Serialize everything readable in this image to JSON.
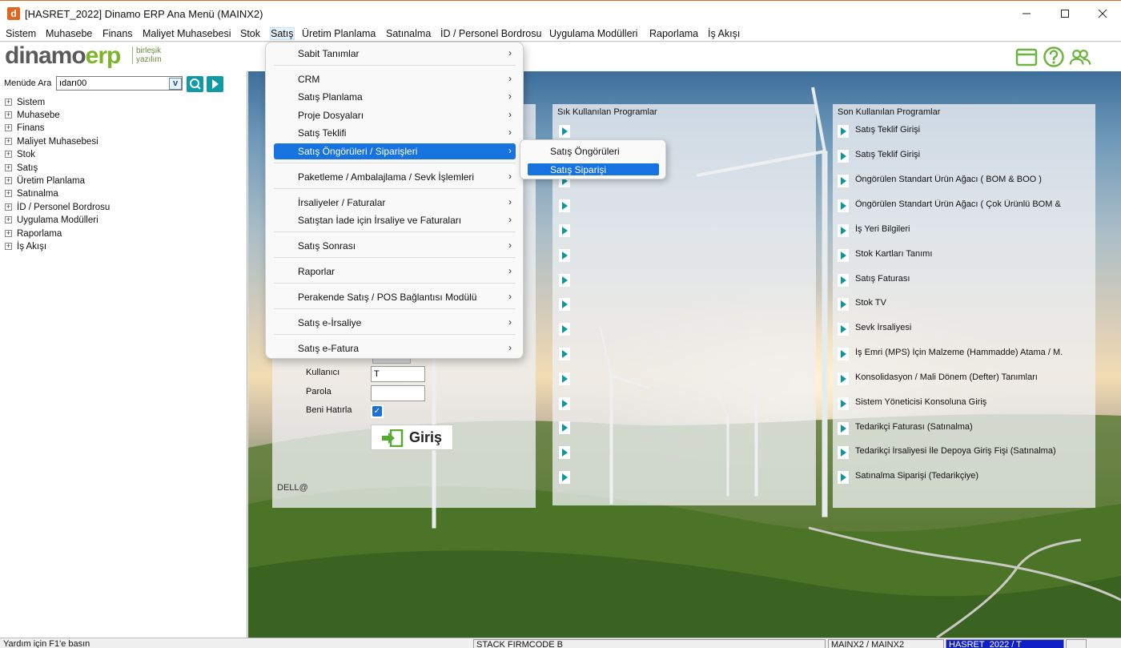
{
  "window": {
    "title": "[HASRET_2022] Dinamo ERP Ana Menü (MAINX2)",
    "app_icon_letter": "d"
  },
  "menubar": [
    "Sistem",
    "Muhasebe",
    "Finans",
    "Maliyet Muhasebesi",
    "Stok",
    "Satış",
    "Üretim Planlama",
    "Satınalma",
    "İD / Personel Bordrosu",
    "Uygulama Modülleri",
    "Raporlama",
    "İş Akışı"
  ],
  "logo": {
    "main1": "dinamo",
    "main2": "erp",
    "sub1": "birleşik",
    "sub2": "yazılım"
  },
  "sidebar": {
    "search_label": "Menüde Ara",
    "search_value": "ıdarı00",
    "tree": [
      "Sistem",
      "Muhasebe",
      "Finans",
      "Maliyet Muhasebesi",
      "Stok",
      "Satış",
      "Üretim Planlama",
      "Satınalma",
      "İD / Personel Bordrosu",
      "Uygulama Modülleri",
      "Raporlama",
      "İş Akışı"
    ]
  },
  "dropdown": [
    {
      "label": "Sabit Tanımlar",
      "highlighted": false
    },
    {
      "label": "CRM",
      "highlighted": false
    },
    {
      "label": "Satış Planlama",
      "highlighted": false
    },
    {
      "label": "Proje Dosyaları",
      "highlighted": false
    },
    {
      "label": "Satış Teklifi",
      "highlighted": false
    },
    {
      "label": "Satış Öngörüleri / Siparişleri",
      "highlighted": true
    },
    {
      "label": "Paketleme / Ambalajlama / Sevk İşlemleri",
      "highlighted": false
    },
    {
      "label": "İrsaliyeler / Faturalar",
      "highlighted": false
    },
    {
      "label": "Satıştan İade için İrsaliye ve Faturaları",
      "highlighted": false
    },
    {
      "label": "Satış Sonrası",
      "highlighted": false
    },
    {
      "label": "Raporlar",
      "highlighted": false
    },
    {
      "label": "Perakende Satış / POS Bağlantısı Modülü",
      "highlighted": false
    },
    {
      "label": "Satış e-İrsaliye",
      "highlighted": false
    },
    {
      "label": "Satış e-Fatura",
      "highlighted": false
    }
  ],
  "submenu": [
    {
      "label": "Satış Öngörüleri",
      "highlighted": false
    },
    {
      "label": "Satış Siparişi",
      "highlighted": true
    }
  ],
  "login": {
    "user_label": "Kullanıcı",
    "user_value": "T",
    "password_label": "Parola",
    "remember_label": "Beni Hatırla",
    "remember_checked": true,
    "button_label": "Giriş",
    "pc_label": "DELL@"
  },
  "frequent": {
    "title": "Sık Kullanılan Programlar"
  },
  "recent": {
    "title": "Son Kullanılan Programlar",
    "items": [
      "Satış Teklif Girişi",
      "Satış Teklif Girişi",
      "Öngörülen Standart Ürün Ağacı ( BOM & BOO )",
      "Öngörülen Standart Ürün Ağacı ( Çok Ürünlü BOM & BOO )",
      "İş Yeri Bilgileri",
      "Stok Kartları Tanımı",
      "Satış Faturası",
      "Stok TV",
      "Sevk İrsaliyesi",
      "İş Emri (MPS) İçin Malzeme (Hammadde) Atama  / M...",
      "Konsolidasyon / Mali Dönem (Defter) Tanımları",
      "Sistem Yöneticisi Konsoluna Giriş",
      "Tedarikçi Faturası (Satınalma)",
      "Tedarikçi İrsaliyesi İle Depoya Giriş Fişi (Satınalma)",
      "Satınalma Siparişi (Tedarikçiye)"
    ]
  },
  "status": {
    "help": "Yardım için F1'e basın",
    "firm": "STACK FIRMCODE  B",
    "db": "MAINX2 / MAINX2",
    "user": "HASRET_2022 / T"
  },
  "colors": {
    "accent": "#1673e0",
    "teal": "#13959f",
    "brand_green": "#7bb62a",
    "title_accent": "#e0651f"
  }
}
